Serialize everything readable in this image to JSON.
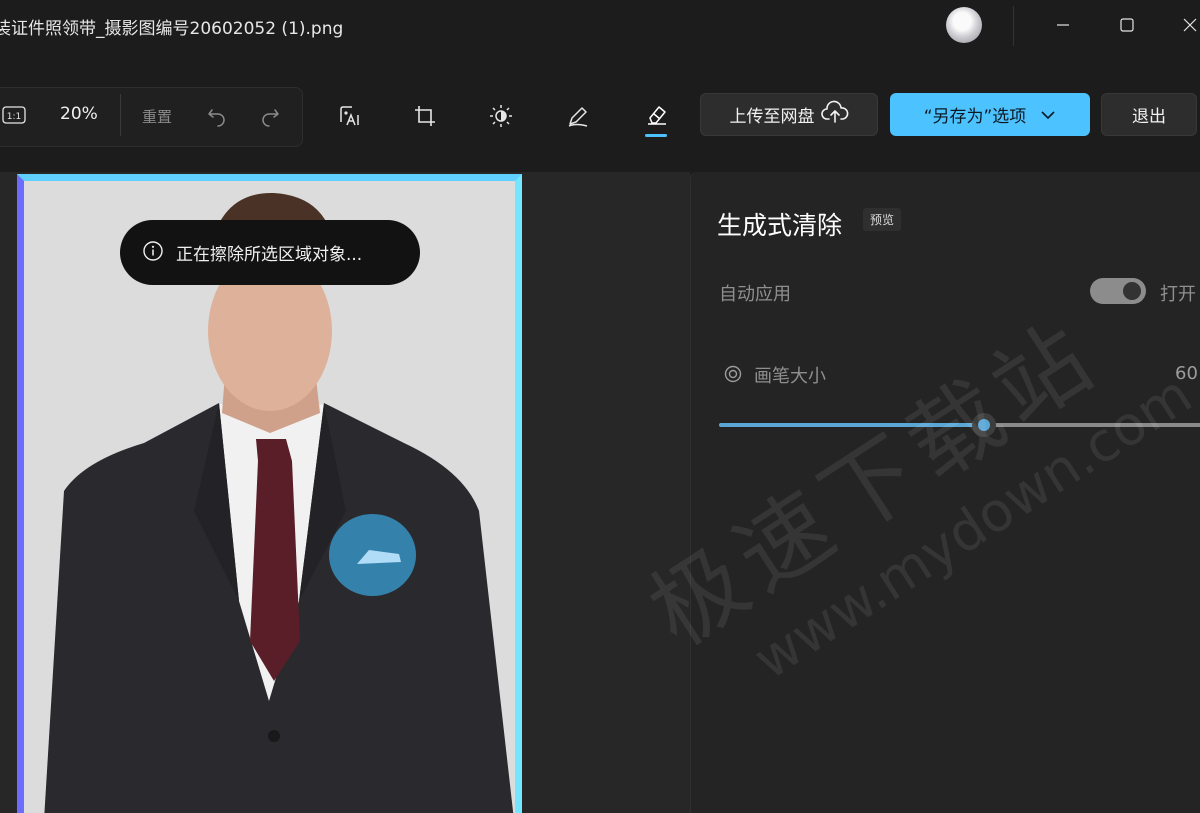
{
  "window": {
    "title": "装证件照领带_摄影图编号20602052 (1).png",
    "avatar_icon": "user-avatar",
    "controls": [
      "minimize-icon",
      "maximize-icon",
      "close-icon"
    ]
  },
  "toolbar": {
    "actual_size_icon": "1:1",
    "zoom_level": "20%",
    "reset_label": "重置",
    "undo_icon": "undo-icon",
    "redo_icon": "redo-icon",
    "tools": [
      "background-ai-icon",
      "crop-icon",
      "brightness-icon",
      "markup-icon",
      "erase-icon"
    ],
    "active_tool": "erase-icon",
    "upload_label": "上传至网盘",
    "save_as_label": "“另存为”选项",
    "exit_label": "退出"
  },
  "canvas": {
    "toast_text": "正在擦除所选区域对象..."
  },
  "panel": {
    "title": "生成式清除",
    "badge": "预览",
    "auto_apply_label": "自动应用",
    "auto_apply_state": "打开",
    "auto_apply_on": true,
    "brush_size_label": "画笔大小",
    "brush_size_value": "60",
    "brush_slider_fraction": 0.55
  },
  "watermark": {
    "cn": "极速下载站",
    "en": "www.mydown.com"
  },
  "colors": {
    "accent": "#4cc2ff",
    "background": "#1c1c1c",
    "panel": "#242424"
  }
}
